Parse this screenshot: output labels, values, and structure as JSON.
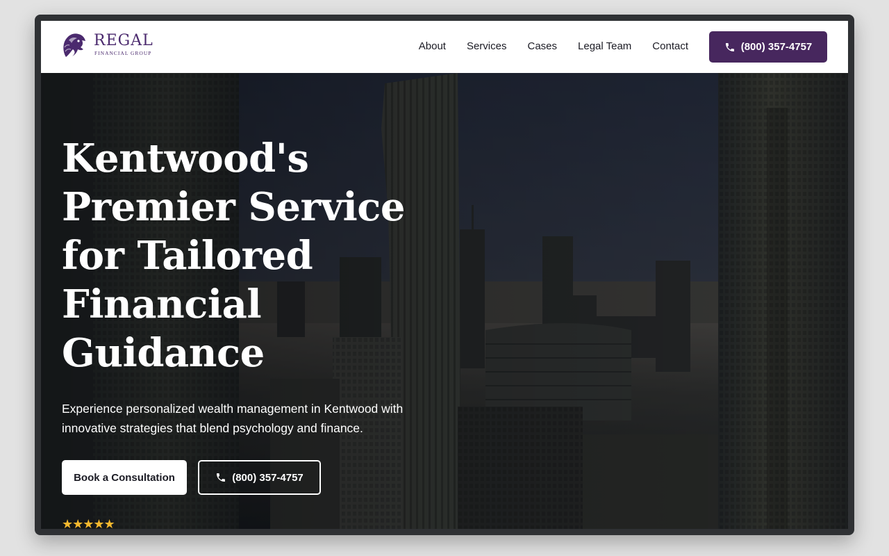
{
  "brand": {
    "name": "REGAL",
    "tagline": "FINANCIAL GROUP",
    "color": "#47275e",
    "logo_icon": "lion-head-icon"
  },
  "nav": {
    "items": [
      {
        "label": "About"
      },
      {
        "label": "Services"
      },
      {
        "label": "Cases"
      },
      {
        "label": "Legal Team"
      },
      {
        "label": "Contact"
      }
    ],
    "phone": {
      "label": "(800) 357-4757",
      "icon": "phone-icon"
    }
  },
  "hero": {
    "title_lines": [
      "Kentwood's",
      "Premier Service",
      "for Tailored",
      "Financial",
      "Guidance"
    ],
    "subtitle": "Experience personalized wealth management in Kentwood with innovative strategies that blend psychology and finance.",
    "background": "city skyline photo",
    "primary_cta": "Book a Consultation",
    "secondary_cta": {
      "label": "(800) 357-4757",
      "icon": "phone-icon"
    },
    "rating_stars": "★★★★★",
    "rating": 5,
    "star_color": "#f5b82e"
  }
}
